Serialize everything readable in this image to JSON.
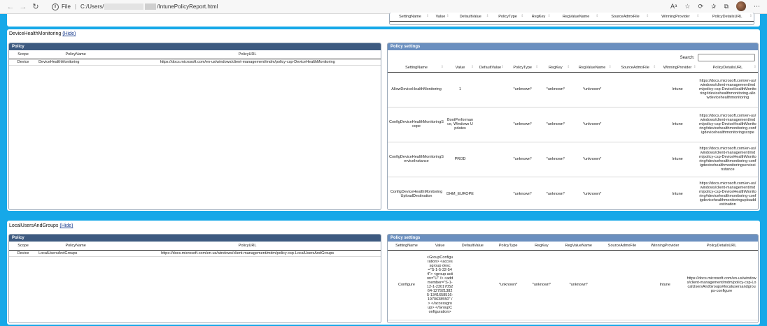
{
  "browser": {
    "file_label": "File",
    "path_prefix": "C:/Users/",
    "path_suffix": "/IntunePolicyReport.html"
  },
  "top_fragment": {
    "columns": [
      "SettingName",
      "Value",
      "DefaultValue",
      "PolicyType",
      "RegKey",
      "RegValueName",
      "SourceAdmxFile",
      "WinningProvider",
      "PolicyDetailsURL"
    ]
  },
  "section1": {
    "title": "DeviceHealthMonitoring",
    "hide_label": "(Hide)",
    "policy_panel": {
      "heading": "Policy",
      "columns": [
        "Scope",
        "PolicyName",
        "PolicyURL"
      ],
      "rows": [
        [
          "Device",
          "DeviceHealthMonitoring",
          "https://docs.microsoft.com/en-us/windows/client-management/mdm/policy-csp-DeviceHealthMonitoring"
        ]
      ]
    },
    "settings_panel": {
      "heading": "Policy settings",
      "search_label": "Search:",
      "columns": [
        "SettingName",
        "Value",
        "DefaultValue",
        "PolicyType",
        "RegKey",
        "RegValueName",
        "SourceAdmxFile",
        "WinningProvider",
        "PolicyDetailsURL"
      ],
      "rows": [
        [
          "AllowDeviceHealthMonitoring",
          "1",
          "",
          "*unknown*",
          "*unknown*",
          "*unknown*",
          "",
          "Intune",
          "https://docs.microsoft.com/en-us/windows/client-management/mdm/policy-csp-DeviceHealthMonitoring#devicehealthmonitoring-allowdevicehealthmonitoring"
        ],
        [
          "ConfigDeviceHealthMonitoringScope",
          "BootPerformance, Windows Updates",
          "",
          "*unknown*",
          "*unknown*",
          "*unknown*",
          "",
          "Intune",
          "https://docs.microsoft.com/en-us/windows/client-management/mdm/policy-csp-DeviceHealthMonitoring#devicehealthmonitoring-configdevicehealthmonitoringscope"
        ],
        [
          "ConfigDeviceHealthMonitoringServiceInstance",
          "PROD",
          "",
          "*unknown*",
          "*unknown*",
          "*unknown*",
          "",
          "Intune",
          "https://docs.microsoft.com/en-us/windows/client-management/mdm/policy-csp-DeviceHealthMonitoring#devicehealthmonitoring-configdevicehealthmonitoringserviceinstance"
        ],
        [
          "ConfigDeviceHealthMonitoringUploadDestination",
          "DHM_EUROPE",
          "",
          "*unknown*",
          "*unknown*",
          "*unknown*",
          "",
          "Intune",
          "https://docs.microsoft.com/en-us/windows/client-management/mdm/policy-csp-DeviceHealthMonitoring#devicehealthmonitoring-configdevicehealthmonitoringuploaddestination"
        ]
      ]
    }
  },
  "section2": {
    "title": "LocalUsersAndGroups",
    "hide_label": "(Hide)",
    "policy_panel": {
      "heading": "Policy",
      "columns": [
        "Scope",
        "PolicyName",
        "PolicyURL"
      ],
      "rows": [
        [
          "Device",
          "LocalUsersAndGroups",
          "https://docs.microsoft.com/en-us/windows/client-management/mdm/policy-csp-LocalUsersAndGroups"
        ]
      ]
    },
    "settings_panel": {
      "heading": "Policy settings",
      "columns": [
        "SettingName",
        "Value",
        "DefaultValue",
        "PolicyType",
        "RegKey",
        "RegValueName",
        "SourceAdmxFile",
        "WinningProvider",
        "PolicyDetailsURL"
      ],
      "rows": [
        [
          "Configure",
          "<GroupConfiguration> <accessgroup desc=\"S-1-5-32-544\"> <group action=\"U\" /> <add member=\"S-1-12-1-2301705264-1279213825-1341658516-1970638550\" /> </accessgroup> </GroupConfiguration>",
          "",
          "*unknown*",
          "*unknown*",
          "*unknown*",
          "",
          "Intune",
          "https://docs.microsoft.com/en-us/windows/client-management/mdm/policy-csp-LocalUsersAndGroups#localusersandgroups-configure"
        ]
      ]
    }
  }
}
